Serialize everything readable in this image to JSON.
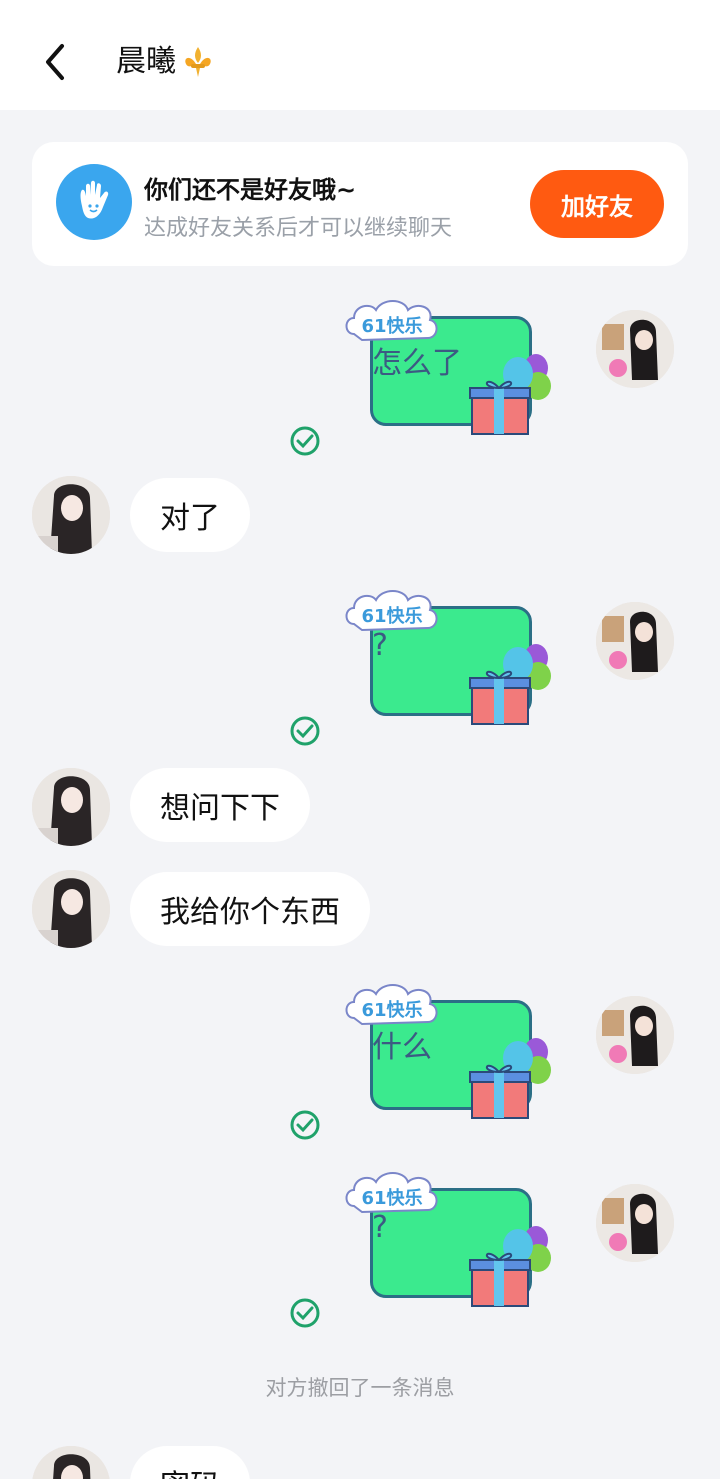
{
  "header": {
    "title": "晨曦",
    "back_icon": "chevron-left-icon",
    "title_icon": "fleur-de-lis-icon"
  },
  "friend_card": {
    "title": "你们还不是好友哦~",
    "subtitle": "达成好友关系后才可以继续聊天",
    "button_label": "加好友",
    "icon": "waving-hand-icon",
    "accent": "#ff5a11"
  },
  "sticker": {
    "badge": "61快乐"
  },
  "messages": [
    {
      "side": "right",
      "type": "sticker",
      "text": "怎么了",
      "status": "read"
    },
    {
      "side": "left",
      "type": "text",
      "text": "对了"
    },
    {
      "side": "right",
      "type": "sticker",
      "text": "?",
      "status": "read"
    },
    {
      "side": "left",
      "type": "text",
      "text": "想问下下"
    },
    {
      "side": "left",
      "type": "text",
      "text": "我给你个东西"
    },
    {
      "side": "right",
      "type": "sticker",
      "text": "什么",
      "status": "read"
    },
    {
      "side": "right",
      "type": "sticker",
      "text": "?",
      "status": "read"
    }
  ],
  "recall_notice": "对方撤回了一条消息",
  "last_message": {
    "side": "left",
    "type": "text",
    "text": "密码"
  }
}
